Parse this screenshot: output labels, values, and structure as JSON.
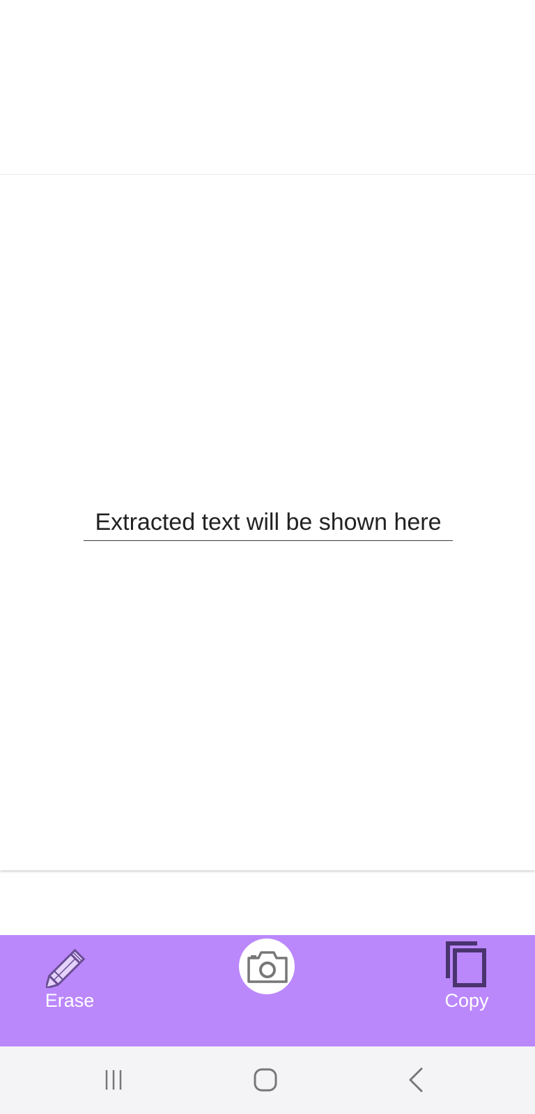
{
  "app": {
    "accent_color": "#bb88fb"
  },
  "content": {
    "extracted_text_placeholder": "Extracted text will be shown here"
  },
  "bottom_bar": {
    "erase": {
      "label": "Erase",
      "icon": "pencil-icon"
    },
    "camera": {
      "icon": "camera-icon"
    },
    "copy": {
      "label": "Copy",
      "icon": "copy-icon"
    }
  },
  "system_nav": {
    "recents_icon": "recents-icon",
    "home_icon": "home-icon",
    "back_icon": "back-icon"
  }
}
